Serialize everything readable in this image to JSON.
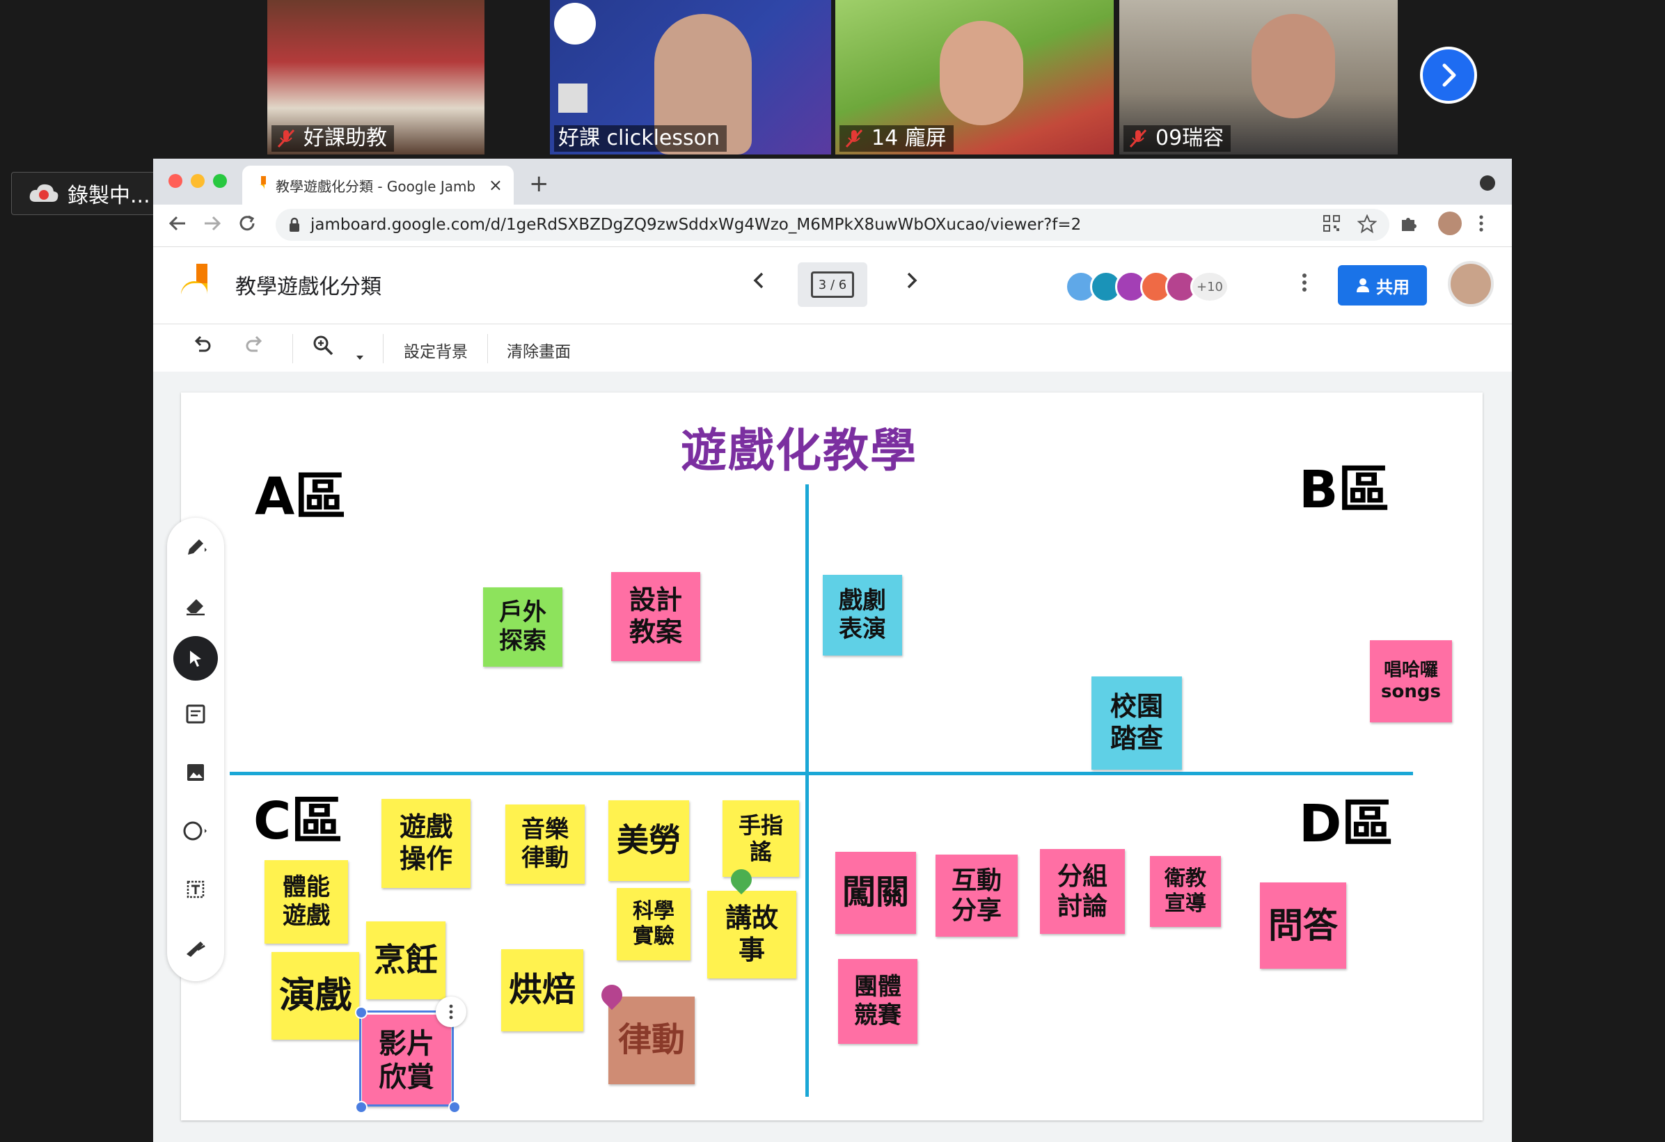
{
  "participants": [
    {
      "name": "好課助教",
      "muted": true
    },
    {
      "name": "好課 clicklesson",
      "muted": false,
      "active": true
    },
    {
      "name": "14 龐屏",
      "muted": true
    },
    {
      "name": "09瑞容",
      "muted": true
    }
  ],
  "participants_next_icon": "chevron-right-icon",
  "recording": {
    "label": "錄製中..."
  },
  "browser": {
    "tab_title": "教學遊戲化分類 - Google Jamb",
    "tab_close": "×",
    "new_tab": "+",
    "url": "jamboard.google.com/d/1geRdSXBZDgZQ9zwSddxWg4Wzo_M6MPkX8uwWbOXucao/viewer?f=2"
  },
  "jamboard": {
    "title": "教學遊戲化分類",
    "frame_indicator": "3 / 6",
    "collaborators_more": "+10",
    "share_label": "共用",
    "toolbar": {
      "set_background": "設定背景",
      "clear_frame": "清除畫面"
    }
  },
  "board": {
    "title": "遊戲化教學",
    "zones": {
      "a": "A區",
      "b": "B區",
      "c": "C區",
      "d": "D區"
    },
    "notes": {
      "outdoor": "戶外\n探索",
      "design": "設計\n教案",
      "drama": "戲劇\n表演",
      "campus": "校園\n踏查",
      "songs": "唱哈囉\nsongs",
      "game_op": "遊戲\n操作",
      "music": "音樂\n律動",
      "art": "美勞",
      "finger": "手指\n謠",
      "physical": "體能\n遊戲",
      "science": "科學\n實驗",
      "story": "講故\n事",
      "cooking": "烹飪",
      "acting": "演戲",
      "baking": "烘焙",
      "rhythm": "律動",
      "video": "影片\n欣賞",
      "level": "闖關",
      "interact": "互動\n分享",
      "group": "分組\n討論",
      "health": "衛教\n宣導",
      "qa": "問答",
      "team": "團體\n競賽"
    }
  },
  "colors": {
    "title_purple": "#7b2fa0",
    "axis_blue": "#1aa7d6",
    "note_pink": "#ff6fa4",
    "note_yellow": "#fff24f",
    "note_cyan": "#5fd0e6",
    "note_green": "#8de35c",
    "note_brown": "#cf8c74",
    "share_blue": "#1a73e8"
  }
}
